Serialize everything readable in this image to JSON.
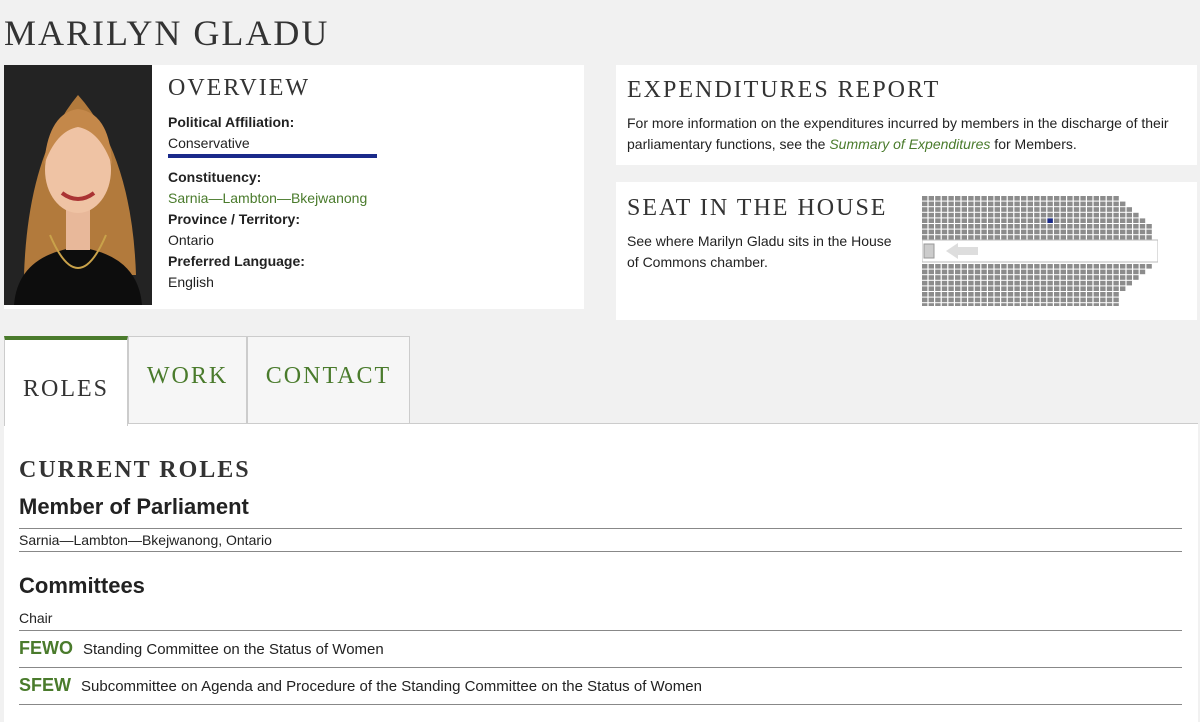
{
  "member": {
    "name": "MARILYN GLADU"
  },
  "overview": {
    "title": "OVERVIEW",
    "affiliation_label": "Political Affiliation:",
    "affiliation_value": "Conservative",
    "constituency_label": "Constituency:",
    "constituency_value": "Sarnia—Lambton—Bkejwanong",
    "province_label": "Province / Territory:",
    "province_value": "Ontario",
    "language_label": "Preferred Language:",
    "language_value": "English",
    "party_color": "#1a2a8a"
  },
  "expenditures": {
    "title": "EXPENDITURES REPORT",
    "text_before": "For more information on the expenditures incurred by members in the discharge of their parliamentary functions, see the ",
    "link": "Summary of Expenditures",
    "text_after": " for Members."
  },
  "seat": {
    "title": "SEAT IN THE HOUSE",
    "text": "See where Marilyn Gladu sits in the House of Commons chamber.",
    "highlight_color": "#1a2a8a"
  },
  "tabs": [
    {
      "label": "ROLES",
      "active": true
    },
    {
      "label": "WORK",
      "active": false
    },
    {
      "label": "CONTACT",
      "active": false
    }
  ],
  "roles": {
    "title": "CURRENT ROLES",
    "mp_heading": "Member of Parliament",
    "mp_riding": "Sarnia—Lambton—Bkejwanong, Ontario",
    "committees_heading": "Committees",
    "committee_role": "Chair",
    "committees": [
      {
        "abbr": "FEWO",
        "name": "Standing Committee on the Status of Women"
      },
      {
        "abbr": "SFEW",
        "name": "Subcommittee on Agenda and Procedure of the Standing Committee on the Status of Women"
      }
    ]
  },
  "colors": {
    "accent_green": "#4a7b2c",
    "background": "#f1f1f1"
  }
}
